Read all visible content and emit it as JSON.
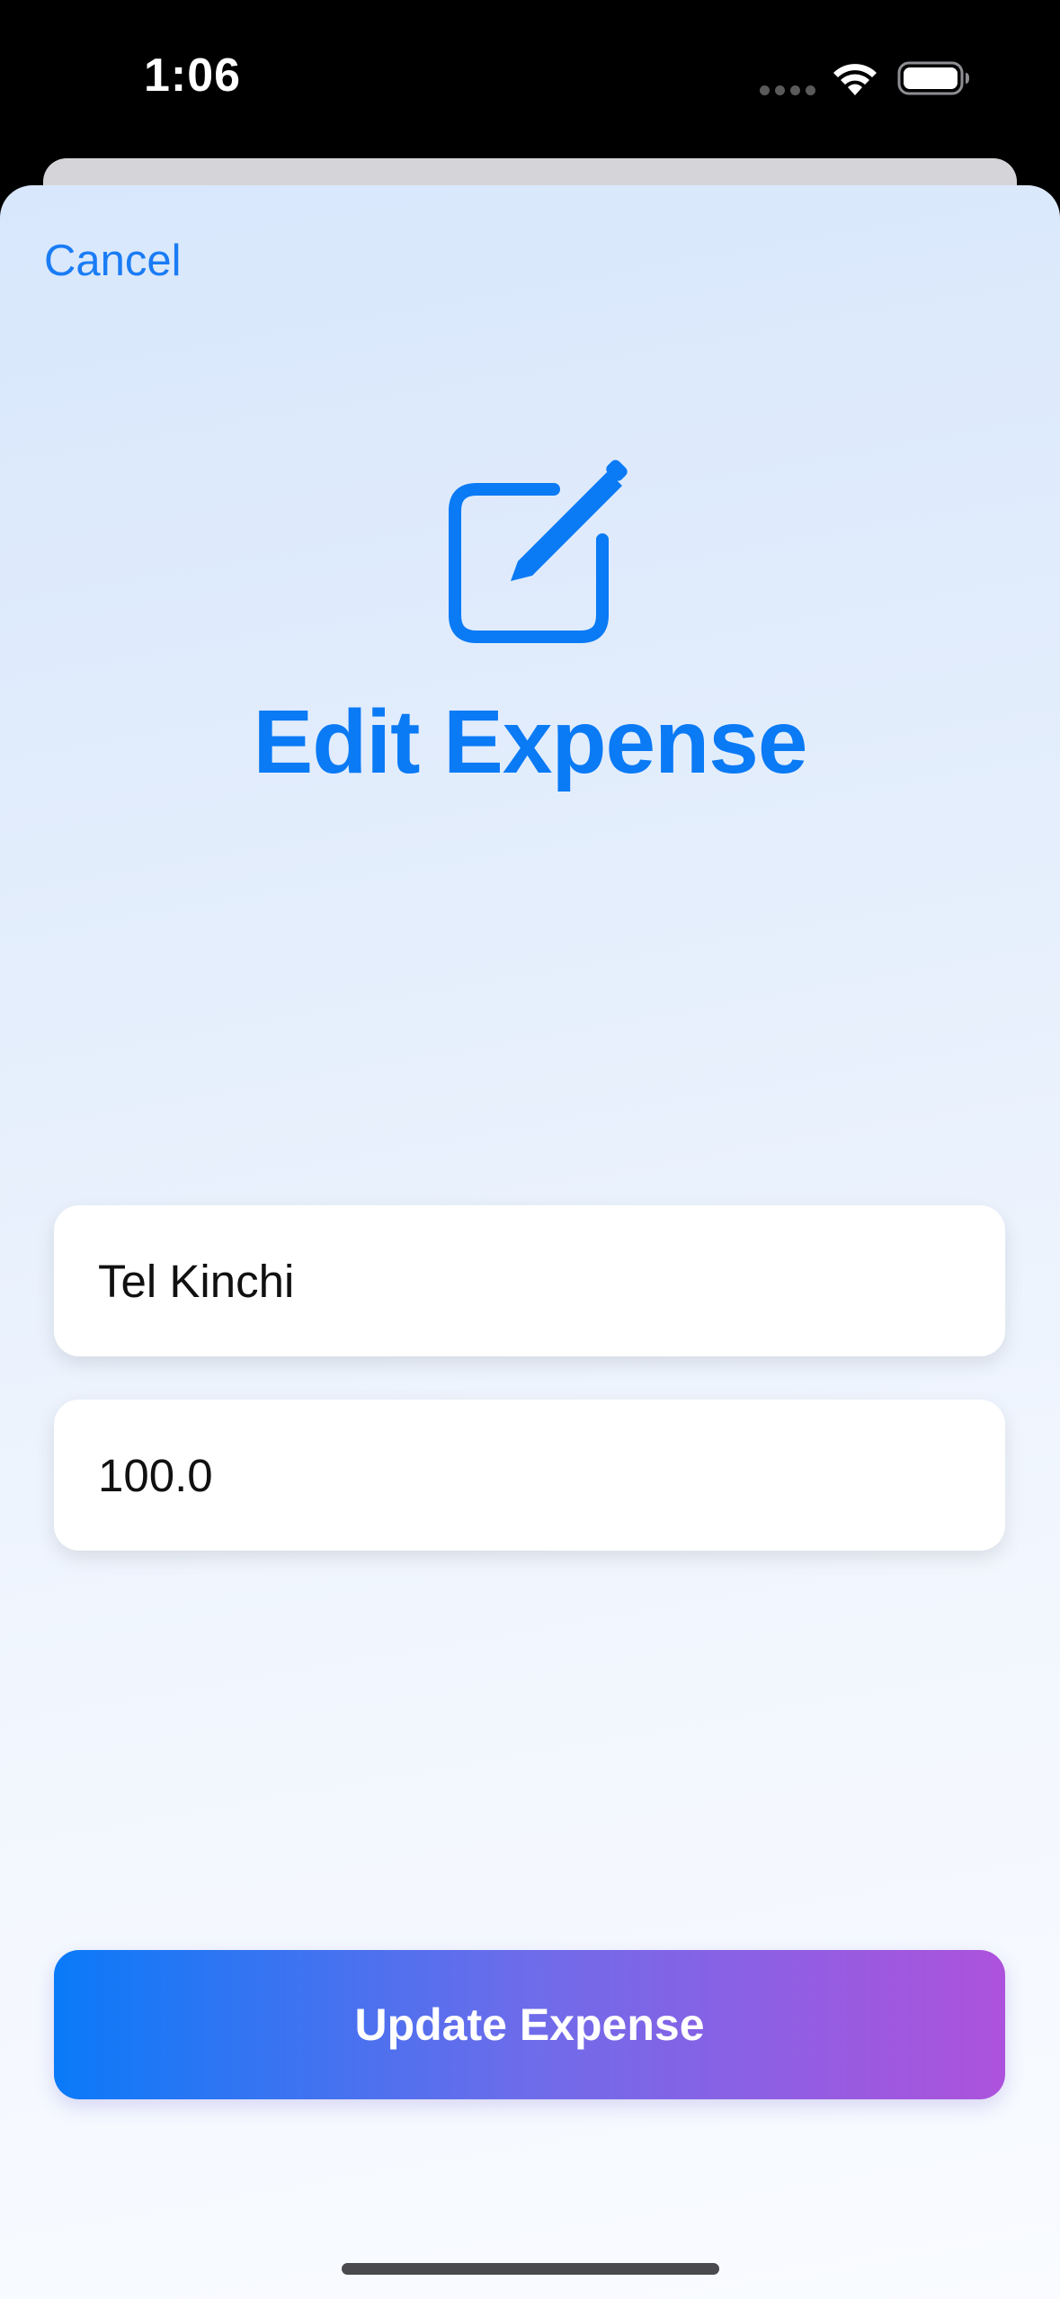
{
  "status_bar": {
    "time": "1:06"
  },
  "sheet": {
    "cancel_label": "Cancel",
    "title": "Edit Expense",
    "icon": "square-and-pencil-icon",
    "fields": {
      "name_value": "Tel Kinchi",
      "amount_value": "100.0"
    },
    "update_label": "Update Expense"
  },
  "colors": {
    "accent": "#0A7AF5",
    "button_gradient_start": "#0A7AF8",
    "button_gradient_end": "#AD52DC",
    "background_top": "#D8E7FC",
    "background_bottom": "#F9FBFF"
  }
}
